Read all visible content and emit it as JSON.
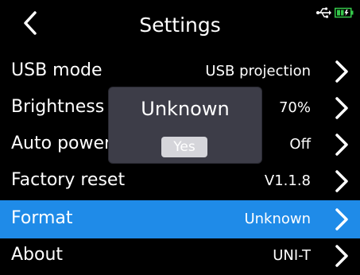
{
  "header": {
    "title": "Settings"
  },
  "rows": [
    {
      "label": "USB mode",
      "value": "USB projection"
    },
    {
      "label": "Brightness",
      "value": "70%"
    },
    {
      "label": "Auto power off",
      "value": "Off"
    },
    {
      "label": "Factory reset",
      "value": "V1.1.8"
    },
    {
      "label": "Format",
      "value": "Unknown",
      "selected": true
    },
    {
      "label": "About",
      "value": "UNI-T"
    }
  ],
  "dialog": {
    "title": "Unknown",
    "button": "Yes"
  },
  "colors": {
    "selection": "#1f8be8",
    "background": "#000000",
    "battery": "#35c94a"
  },
  "icons": [
    "back-arrow-icon",
    "usb-icon",
    "battery-charging-icon",
    "chevron-right-icon"
  ]
}
